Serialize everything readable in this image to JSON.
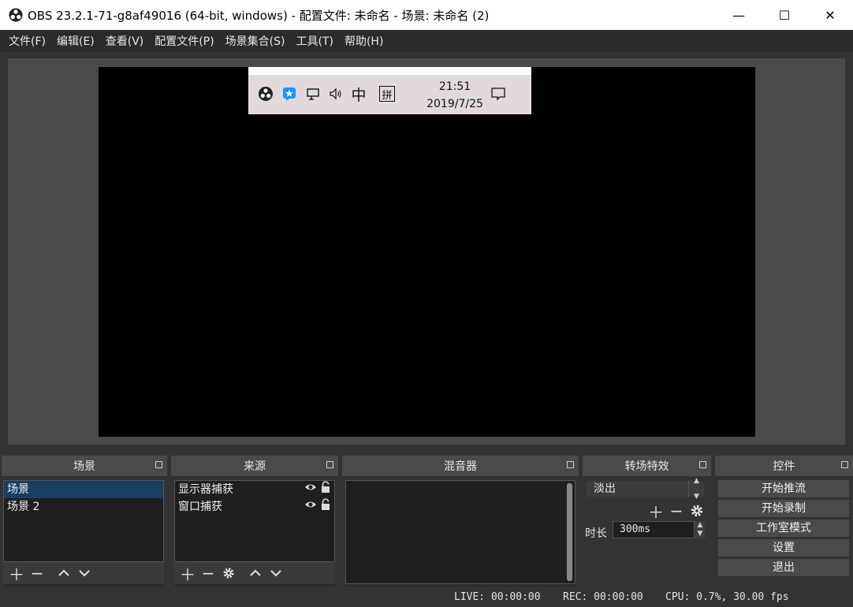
{
  "window": {
    "title": "OBS 23.2.1-71-g8af49016 (64-bit, windows) - 配置文件: 未命名 - 场景: 未命名 (2)",
    "minimize": "—",
    "maximize": "☐",
    "close": "✕"
  },
  "menu": [
    "文件(F)",
    "编辑(E)",
    "查看(V)",
    "配置文件(P)",
    "场景集合(S)",
    "工具(T)",
    "帮助(H)"
  ],
  "preview": {
    "tray": {
      "time": "21:51",
      "date": "2019/7/25",
      "ime_lang": "中",
      "ime_mode": "拼"
    }
  },
  "docks": {
    "scenes": {
      "title": "场景",
      "items": [
        {
          "label": "场景",
          "selected": true
        },
        {
          "label": "场景 2",
          "selected": false
        }
      ]
    },
    "sources": {
      "title": "来源",
      "items": [
        {
          "label": "显示器捕获"
        },
        {
          "label": "窗口捕获"
        }
      ]
    },
    "mixer": {
      "title": "混音器"
    },
    "transitions": {
      "title": "转场特效",
      "selected": "淡出",
      "duration_label": "时长",
      "duration_value": "300ms"
    },
    "controls": {
      "title": "控件",
      "buttons": [
        "开始推流",
        "开始录制",
        "工作室模式",
        "设置",
        "退出"
      ]
    }
  },
  "status": {
    "live": "LIVE: 00:00:00",
    "rec": "REC: 00:00:00",
    "cpu": "CPU: 0.7%, 30.00 fps"
  },
  "colors": {
    "background": "#333333",
    "selected_row": "#1b3e60",
    "header": "#4a4a4a"
  }
}
